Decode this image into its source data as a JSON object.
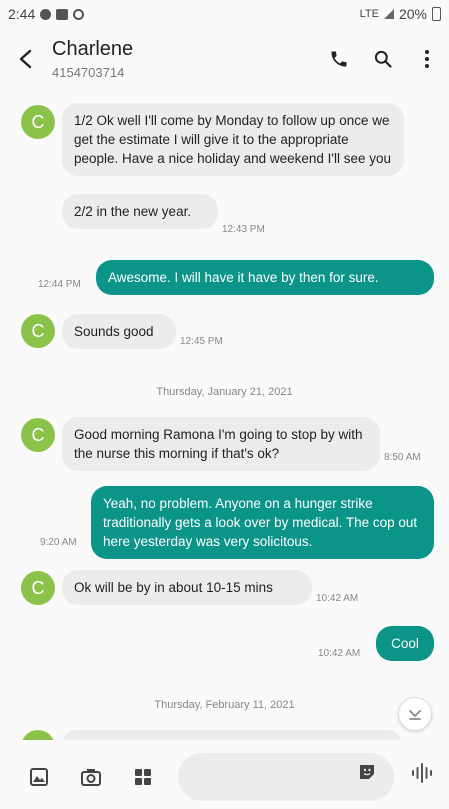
{
  "status_bar": {
    "time": "2:44",
    "network": "LTE",
    "battery": "20%"
  },
  "header": {
    "contact_name": "Charlene",
    "contact_number": "4154703714",
    "icons": [
      "back-icon",
      "phone-icon",
      "search-icon",
      "more-icon"
    ]
  },
  "thread": {
    "avatar_letter": "C",
    "avatar_color": "#8bc34a",
    "outgoing_color": "#0b9488",
    "messages": [
      {
        "dir": "in",
        "text": "1/2 Ok well I'll come by Monday to follow up once we get the estimate I will give it to the appropriate people. Have a nice holiday and weekend I'll see you",
        "time": ""
      },
      {
        "dir": "in",
        "text": "2/2 in the new year.",
        "time": "12:43 PM"
      },
      {
        "dir": "out",
        "text": "Awesome.  I will have it have by then for sure.",
        "time": "12:44 PM"
      },
      {
        "dir": "in",
        "text": "Sounds good",
        "time": "12:45 PM"
      },
      {
        "dir": "in",
        "text": "Good morning Ramona I'm going to stop by with the nurse this morning if that's ok?",
        "time": "8:50 AM"
      },
      {
        "dir": "out",
        "text": "Yeah, no problem.  Anyone on a hunger strike traditionally gets a look over by medical.  The cop out here yesterday was very solicitous.",
        "time": "9:20 AM"
      },
      {
        "dir": "in",
        "text": "Ok will be by in about 10-15 mins",
        "time": "10:42 AM"
      },
      {
        "dir": "out",
        "text": "Cool",
        "time": "10:42 AM"
      }
    ],
    "date_separators": [
      "Thursday, January 21, 2021",
      "Thursday, February 11, 2021"
    ]
  },
  "composer": {
    "placeholder": "",
    "icons": [
      "gallery-icon",
      "camera-icon",
      "apps-icon",
      "sticker-icon",
      "voice-icon"
    ]
  }
}
